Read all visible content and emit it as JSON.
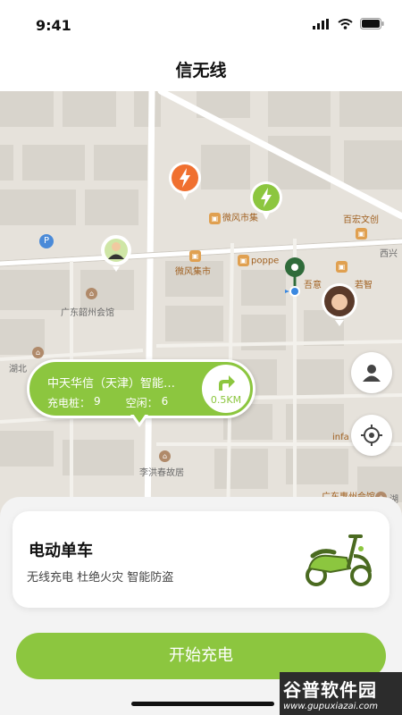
{
  "status": {
    "time": "9:41"
  },
  "nav": {
    "title": "信无线"
  },
  "map": {
    "labels": {
      "poi_weifeng1": "微风市集",
      "poi_weifeng2": "微风集市",
      "poi_poppe": "poppe",
      "poi_baihong": "百宏文创",
      "poi_xixing": "西兴",
      "poi_wuyin": "吾意",
      "poi_ruozhi": "若智",
      "poi_guangdong_shao": "广东韶州会馆",
      "poi_hubei": "湖北",
      "poi_lihongchun": "李洪春故居",
      "poi_infa": "infa",
      "poi_guangdong_hui": "广东惠州会馆",
      "poi_hu": "湖"
    },
    "parking_letter": "P"
  },
  "station": {
    "name": "中天华信（天津）智能…",
    "pile_label": "充电桩：",
    "pile_count": "9",
    "free_label": "空闲：",
    "free_count": "6",
    "distance": "0.5KM"
  },
  "card": {
    "title": "电动单车",
    "subtitle": "无线充电 杜绝火灾 智能防盗"
  },
  "actions": {
    "start": "开始充电"
  },
  "watermark": {
    "top": "谷普软件园",
    "bottom": "www.gupuxiazai.com"
  },
  "colors": {
    "accent": "#8cc63f",
    "orange_marker": "#f07030",
    "map_bg": "#e6e2db",
    "pin_green": "#3a7a3a"
  },
  "icons": [
    "signal-icon",
    "wifi-icon",
    "battery-icon",
    "lightning-icon",
    "location-pin-icon",
    "user-icon",
    "locate-icon",
    "arrow-icon",
    "scooter-icon"
  ]
}
